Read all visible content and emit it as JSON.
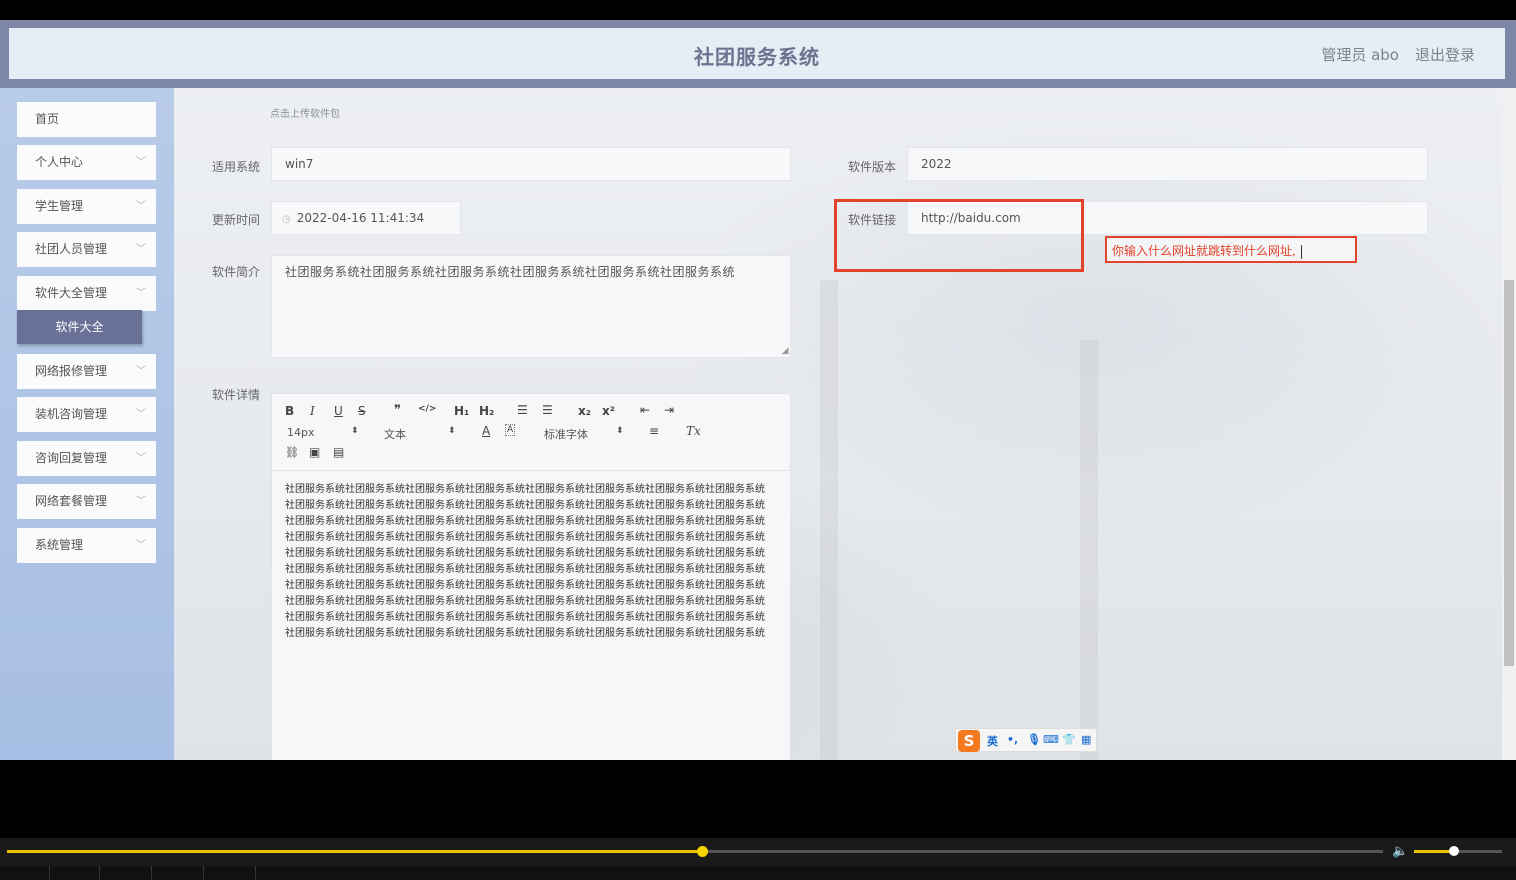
{
  "header": {
    "title": "社团服务系统",
    "user": "管理员 abo",
    "logout": "退出登录"
  },
  "sidebar": {
    "items": [
      {
        "label": "首页",
        "has_chevron": false
      },
      {
        "label": "个人中心",
        "has_chevron": true
      },
      {
        "label": "学生管理",
        "has_chevron": true
      },
      {
        "label": "社团人员管理",
        "has_chevron": true
      },
      {
        "label": "软件大全管理",
        "has_chevron": true
      },
      {
        "label": "网络报修管理",
        "has_chevron": true
      },
      {
        "label": "装机咨询管理",
        "has_chevron": true
      },
      {
        "label": "咨询回复管理",
        "has_chevron": true
      },
      {
        "label": "网络套餐管理",
        "has_chevron": true
      },
      {
        "label": "系统管理",
        "has_chevron": true
      }
    ],
    "active_sub": "软件大全"
  },
  "form": {
    "upload_hint": "点击上传软件包",
    "os_label": "适用系统",
    "os_value": "win7",
    "version_label": "软件版本",
    "version_value": "2022",
    "updated_label": "更新时间",
    "updated_value": "2022-04-16 11:41:34",
    "link_label": "软件链接",
    "link_value": "http://baidu.com",
    "intro_label": "软件简介",
    "intro_value": "社团服务系统社团服务系统社团服务系统社团服务系统社团服务系统社团服务系统",
    "detail_label": "软件详情"
  },
  "editor": {
    "toolbar": {
      "bold": "B",
      "italic": "I",
      "underline": "U",
      "strike": "S",
      "quote": "❞",
      "code": "</>",
      "h1": "H₁",
      "h2": "H₂",
      "ordered_list": "☰",
      "bullet_list": "☰",
      "subscript": "x₂",
      "superscript": "x²",
      "outdent": "⇤",
      "indent": "⇥",
      "size": "14px",
      "header_select": "文本",
      "font_select": "标准字体",
      "font_color": "A",
      "bg_color": "A",
      "align": "≡",
      "clean": "Tx",
      "link": "🔗",
      "image": "▣",
      "video": "▤"
    },
    "content": "社团服务系统社团服务系统社团服务系统社团服务系统社团服务系统社团服务系统社团服务系统社团服务系统社团服务系统社团服务系统社团服务系统社团服务系统社团服务系统社团服务系统社团服务系统社团服务系统社团服务系统社团服务系统社团服务系统社团服务系统社团服务系统社团服务系统社团服务系统社团服务系统社团服务系统社团服务系统社团服务系统社团服务系统社团服务系统社团服务系统社团服务系统社团服务系统社团服务系统社团服务系统社团服务系统社团服务系统社团服务系统社团服务系统社团服务系统社团服务系统社团服务系统社团服务系统社团服务系统社团服务系统社团服务系统社团服务系统社团服务系统社团服务系统社团服务系统社团服务系统社团服务系统社团服务系统社团服务系统社团服务系统社团服务系统社团服务系统社团服务系统社团服务系统社团服务系统社团服务系统社团服务系统社团服务系统社团服务系统社团服务系统社团服务系统社团服务系统社团服务系统社团服务系统社团服务系统社团服务系统社团服务系统社团服务系统社团服务系统社团服务系统社团服务系统社团服务系统社团服务系统社团服务系统社团服务系统社团服务系统"
  },
  "annotation": {
    "note": "你输入什么网址就跳转到什么网址,"
  },
  "ime": {
    "logo": "S",
    "lang": "英",
    "punct": "•,",
    "mic_icon": "mic-icon",
    "keyboard_icon": "keyboard-icon",
    "skin_icon": "shirt-icon",
    "tools_icon": "grid-icon"
  },
  "player": {
    "progress": 0.505,
    "volume": 0.45
  },
  "colors": {
    "accent": "#6a7196",
    "annotation": "#e2432a",
    "progress": "#e6c200"
  }
}
